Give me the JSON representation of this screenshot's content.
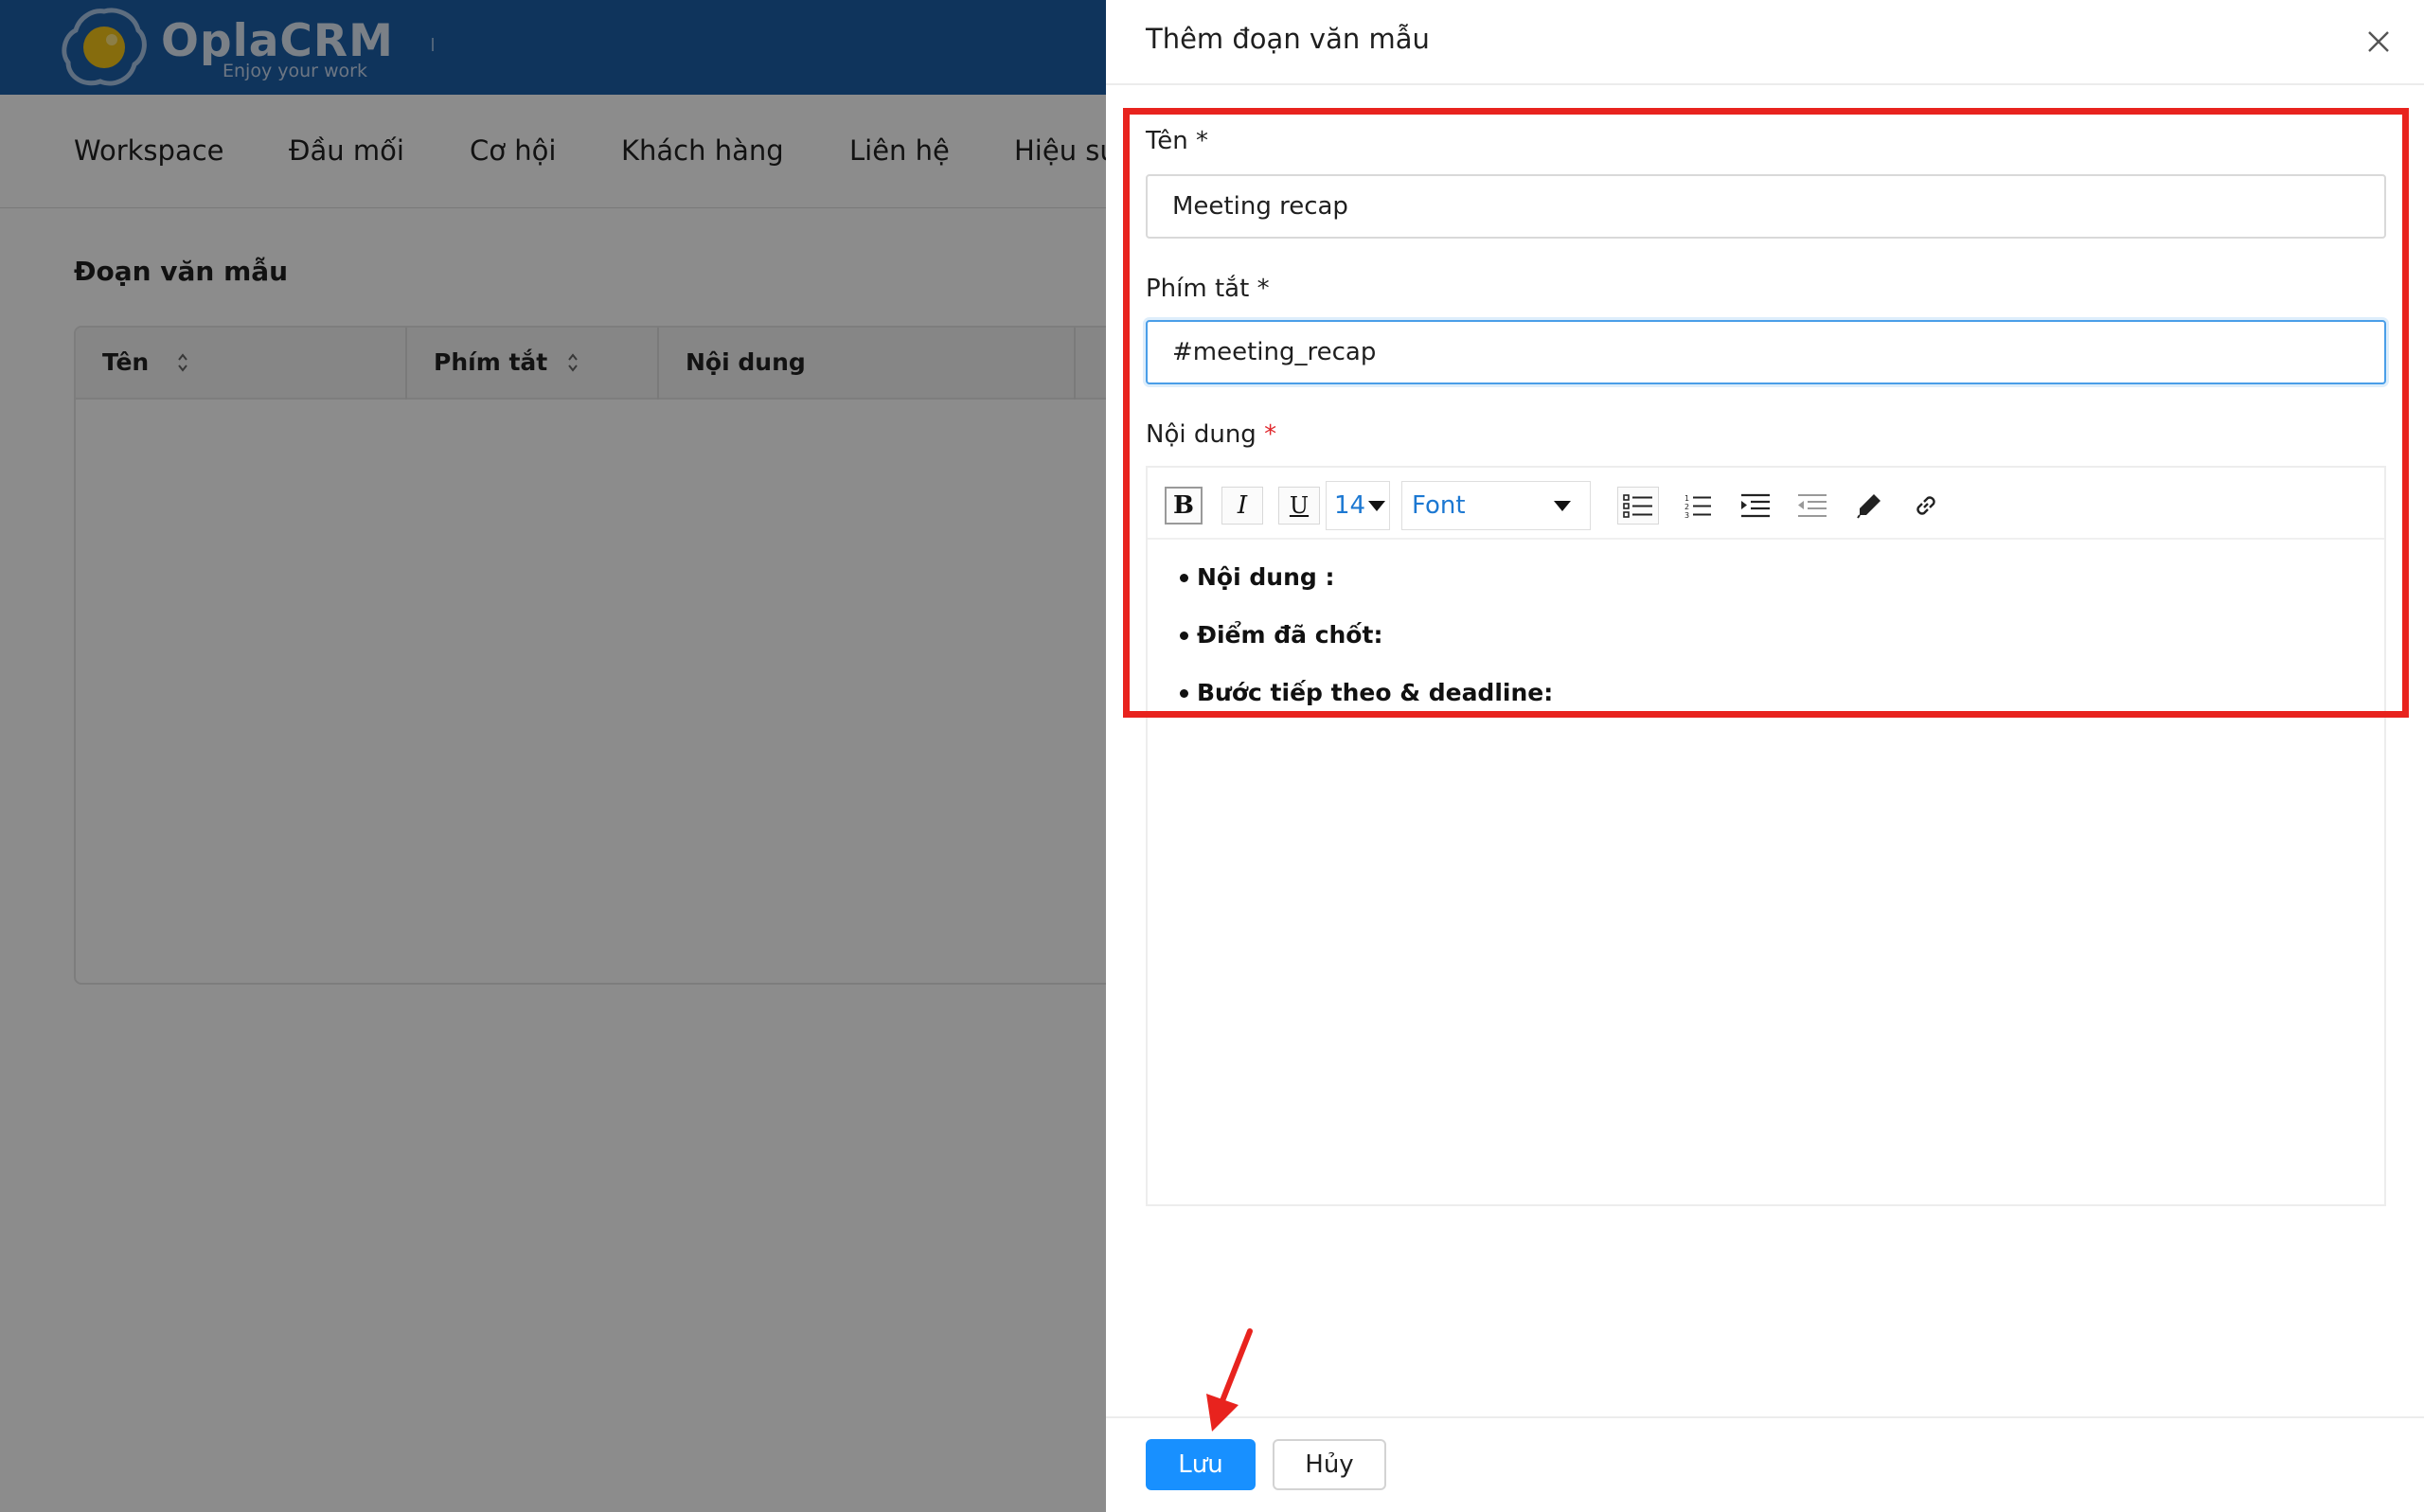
{
  "app": {
    "brand": "OplaCRM",
    "tagline": "Enjoy your work"
  },
  "nav": {
    "items": [
      "Workspace",
      "Đầu mối",
      "Cơ hội",
      "Khách hàng",
      "Liên hệ",
      "Hiệu su"
    ]
  },
  "page": {
    "section_title": "Đoạn văn mẫu",
    "table": {
      "columns": [
        "Tên",
        "Phím tắt",
        "Nội dung"
      ]
    }
  },
  "drawer": {
    "title": "Thêm đoạn văn mẫu",
    "name_field": {
      "label": "Tên",
      "required_mark": "*",
      "value": "Meeting recap"
    },
    "shortcut_field": {
      "label": "Phím tắt",
      "required_mark": "*",
      "value": "#meeting_recap"
    },
    "content_field": {
      "label": "Nội dung",
      "required_mark": "*",
      "toolbar": {
        "bold": "B",
        "italic": "I",
        "underline": "U",
        "font_size": "14",
        "font": "Font"
      },
      "bullets": [
        "Nội dung :",
        "Điểm đã chốt:",
        "Bước tiếp theo & deadline:"
      ]
    },
    "footer": {
      "save_label": "Lưu",
      "cancel_label": "Hủy"
    }
  },
  "colors": {
    "topbar": "#1d5fa8",
    "primary": "#1890ff",
    "highlight": "#e8231e",
    "required": "#e0282d",
    "focus": "#4a9ee8"
  },
  "icons": {
    "close": "close-icon",
    "sort": "sort-icon",
    "bullet_list": "bullet-list-icon",
    "numbered_list": "numbered-list-icon",
    "indent": "indent-icon",
    "outdent": "outdent-icon",
    "pen": "pen-icon",
    "link": "link-icon"
  }
}
